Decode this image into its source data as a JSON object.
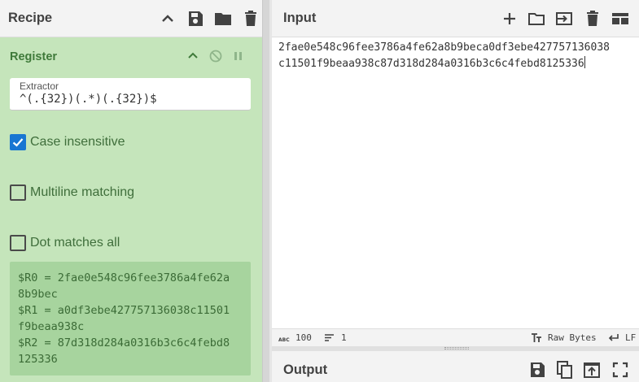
{
  "recipe": {
    "title": "Recipe",
    "header_icons": [
      "chevron-up-icon",
      "save-icon",
      "folder-icon",
      "trash-icon"
    ]
  },
  "operation": {
    "name": "Register",
    "icons": [
      "chevron-up-icon",
      "disable-icon",
      "pause-icon"
    ],
    "extractor_label": "Extractor",
    "extractor_value": "^(.{32})(.*)(.{32})$",
    "case_insensitive": {
      "label": "Case insensitive",
      "checked": true
    },
    "multiline_matching": {
      "label": "Multiline matching",
      "checked": false
    },
    "dot_matches_all": {
      "label": "Dot matches all",
      "checked": false
    },
    "results": [
      "$R0 = 2fae0e548c96fee3786a4fe62a",
      "8b9bec",
      "$R1 = a0df3ebe427757136038c11501",
      "f9beaa938c",
      "$R2 = 87d318d284a0316b3c6c4febd8",
      "125336"
    ]
  },
  "input": {
    "title": "Input",
    "header_icons": [
      "plus-icon",
      "folder-icon",
      "import-icon",
      "trash-icon",
      "layout-icon"
    ],
    "lines": [
      "2fae0e548c96fee3786a4fe62a8b9beca0df3ebe427757136038",
      "c11501f9beaa938c87d318d284a0316b3c6c4febd8125336"
    ]
  },
  "status": {
    "chars": "100",
    "lines": "1",
    "encoding": "Raw Bytes",
    "eol": "LF"
  },
  "output": {
    "title": "Output",
    "header_icons": [
      "save-icon",
      "copy-icon",
      "replace-input-icon",
      "fullscreen-icon"
    ]
  }
}
